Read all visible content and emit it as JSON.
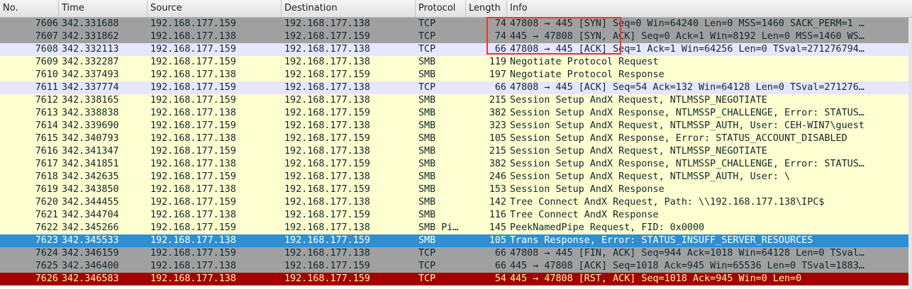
{
  "columns": {
    "no": "No.",
    "time": "Time",
    "source": "Source",
    "destination": "Destination",
    "protocol": "Protocol",
    "length": "Length",
    "info": "Info"
  },
  "packets": [
    {
      "no": "7606",
      "time": "342.331688",
      "src": "192.168.177.159",
      "dst": "192.168.177.138",
      "proto": "TCP",
      "len": "74",
      "info": "47808 → 445 [SYN] Seq=0 Win=64240 Len=0 MSS=1460 SACK_PERM=1 …"
    },
    {
      "no": "7607",
      "time": "342.331862",
      "src": "192.168.177.138",
      "dst": "192.168.177.159",
      "proto": "TCP",
      "len": "74",
      "info": "445 → 47808 [SYN, ACK] Seq=0 Ack=1 Win=8192 Len=0 MSS=1460 WS…"
    },
    {
      "no": "7608",
      "time": "342.332113",
      "src": "192.168.177.159",
      "dst": "192.168.177.138",
      "proto": "TCP",
      "len": "66",
      "info": "47808 → 445 [ACK] Seq=1 Ack=1 Win=64256 Len=0 TSval=271276794…"
    },
    {
      "no": "7609",
      "time": "342.332287",
      "src": "192.168.177.159",
      "dst": "192.168.177.138",
      "proto": "SMB",
      "len": "119",
      "info": "Negotiate Protocol Request"
    },
    {
      "no": "7610",
      "time": "342.337493",
      "src": "192.168.177.138",
      "dst": "192.168.177.159",
      "proto": "SMB",
      "len": "197",
      "info": "Negotiate Protocol Response"
    },
    {
      "no": "7611",
      "time": "342.337774",
      "src": "192.168.177.159",
      "dst": "192.168.177.138",
      "proto": "TCP",
      "len": "66",
      "info": "47808 → 445 [ACK] Seq=54 Ack=132 Win=64128 Len=0 TSval=271276…"
    },
    {
      "no": "7612",
      "time": "342.338165",
      "src": "192.168.177.159",
      "dst": "192.168.177.138",
      "proto": "SMB",
      "len": "215",
      "info": "Session Setup AndX Request, NTLMSSP_NEGOTIATE"
    },
    {
      "no": "7613",
      "time": "342.338838",
      "src": "192.168.177.138",
      "dst": "192.168.177.159",
      "proto": "SMB",
      "len": "382",
      "info": "Session Setup AndX Response, NTLMSSP_CHALLENGE, Error: STATUS…"
    },
    {
      "no": "7614",
      "time": "342.339690",
      "src": "192.168.177.159",
      "dst": "192.168.177.138",
      "proto": "SMB",
      "len": "323",
      "info": "Session Setup AndX Request, NTLMSSP_AUTH, User: CEH-WIN7\\guest"
    },
    {
      "no": "7615",
      "time": "342.340793",
      "src": "192.168.177.138",
      "dst": "192.168.177.159",
      "proto": "SMB",
      "len": "105",
      "info": "Session Setup AndX Response, Error: STATUS_ACCOUNT_DISABLED"
    },
    {
      "no": "7616",
      "time": "342.341347",
      "src": "192.168.177.159",
      "dst": "192.168.177.138",
      "proto": "SMB",
      "len": "215",
      "info": "Session Setup AndX Request, NTLMSSP_NEGOTIATE"
    },
    {
      "no": "7617",
      "time": "342.341851",
      "src": "192.168.177.138",
      "dst": "192.168.177.159",
      "proto": "SMB",
      "len": "382",
      "info": "Session Setup AndX Response, NTLMSSP_CHALLENGE, Error: STATUS…"
    },
    {
      "no": "7618",
      "time": "342.342635",
      "src": "192.168.177.159",
      "dst": "192.168.177.138",
      "proto": "SMB",
      "len": "246",
      "info": "Session Setup AndX Request, NTLMSSP_AUTH, User: \\"
    },
    {
      "no": "7619",
      "time": "342.343850",
      "src": "192.168.177.138",
      "dst": "192.168.177.159",
      "proto": "SMB",
      "len": "153",
      "info": "Session Setup AndX Response"
    },
    {
      "no": "7620",
      "time": "342.344455",
      "src": "192.168.177.159",
      "dst": "192.168.177.138",
      "proto": "SMB",
      "len": "142",
      "info": "Tree Connect AndX Request, Path: \\\\192.168.177.138\\IPC$"
    },
    {
      "no": "7621",
      "time": "342.344704",
      "src": "192.168.177.138",
      "dst": "192.168.177.159",
      "proto": "SMB",
      "len": "116",
      "info": "Tree Connect AndX Response"
    },
    {
      "no": "7622",
      "time": "342.345266",
      "src": "192.168.177.159",
      "dst": "192.168.177.138",
      "proto": "SMB Pi…",
      "len": "145",
      "info": "PeekNamedPipe Request, FID: 0x0000"
    },
    {
      "no": "7623",
      "time": "342.345533",
      "src": "192.168.177.138",
      "dst": "192.168.177.159",
      "proto": "SMB",
      "len": "105",
      "info": "Trans Response, Error: STATUS_INSUFF_SERVER_RESOURCES"
    },
    {
      "no": "7624",
      "time": "342.346159",
      "src": "192.168.177.159",
      "dst": "192.168.177.138",
      "proto": "TCP",
      "len": "66",
      "info": "47808 → 445 [FIN, ACK] Seq=944 Ack=1018 Win=64128 Len=0 TSval…"
    },
    {
      "no": "7625",
      "time": "342.346400",
      "src": "192.168.177.138",
      "dst": "192.168.177.159",
      "proto": "TCP",
      "len": "66",
      "info": "445 → 47808 [ACK] Seq=1018 Ack=945 Win=65536 Len=0 TSval=1883…"
    },
    {
      "no": "7626",
      "time": "342.346583",
      "src": "192.168.177.138",
      "dst": "192.168.177.159",
      "proto": "TCP",
      "len": "54",
      "info": "445 → 47808 [RST, ACK] Seq=1018 Ack=945 Win=0 Len=0"
    }
  ],
  "colors": {
    "tcp_handshake": "#a0a0a0",
    "tcp": "#e7e6ff",
    "smb": "#feffd0",
    "selected": "#2f8fd4",
    "rst": "#a40000",
    "highlight_box": "#e8382f"
  }
}
